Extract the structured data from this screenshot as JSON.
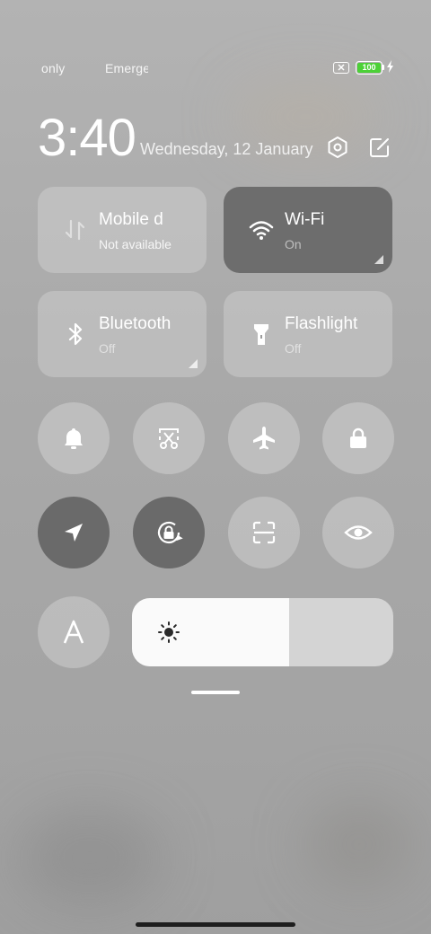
{
  "status_bar": {
    "carrier_left": "only",
    "carrier_right": "Emerge",
    "battery_level": "100",
    "icons": [
      "no-sim-icon",
      "battery-icon",
      "charging-bolt-icon"
    ]
  },
  "header": {
    "time": "3:40",
    "date": "Wednesday, 12 January",
    "settings_icon": "settings-hex-icon",
    "edit_icon": "edit-icon"
  },
  "tiles": [
    {
      "name": "Mobile data",
      "label": "Mobile d",
      "status": "Not available",
      "icon": "mobile-data-icon",
      "active": false
    },
    {
      "name": "Wi-Fi",
      "label": "Wi-Fi",
      "status": "On",
      "icon": "wifi-icon",
      "active": true
    },
    {
      "name": "Bluetooth",
      "label": "Bluetooth",
      "status": "Off",
      "icon": "bluetooth-icon",
      "active": false
    },
    {
      "name": "Flashlight",
      "label": "Flashlight",
      "status": "Off",
      "icon": "flashlight-icon",
      "active": false
    }
  ],
  "toggles": [
    {
      "icon": "bell-icon",
      "active": false
    },
    {
      "icon": "screenshot-icon",
      "active": false
    },
    {
      "icon": "airplane-icon",
      "active": false
    },
    {
      "icon": "lock-icon",
      "active": false
    },
    {
      "icon": "location-icon",
      "active": true
    },
    {
      "icon": "rotation-lock-icon",
      "active": true
    },
    {
      "icon": "scanner-icon",
      "active": false
    },
    {
      "icon": "eye-icon",
      "active": false
    },
    {
      "icon": "font-a-icon",
      "label": "A",
      "active": false
    }
  ],
  "brightness": {
    "icon": "sun-icon",
    "level_percent": 60
  },
  "colors": {
    "active_tile": "#6d6d6d",
    "battery_green": "#4cd137",
    "slider_fill": "#fafafa"
  }
}
